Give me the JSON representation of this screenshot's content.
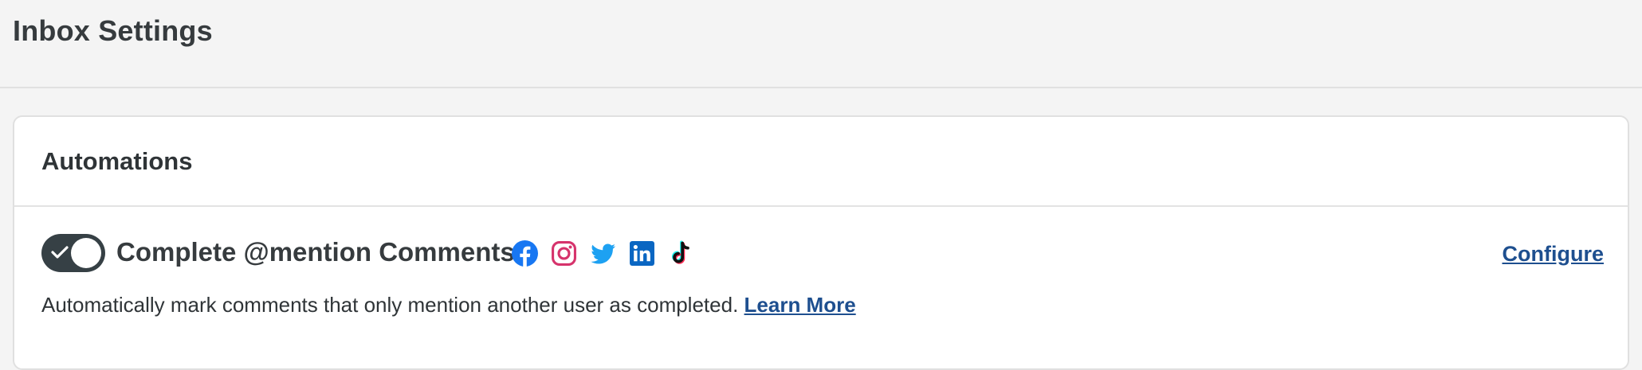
{
  "page": {
    "title": "Inbox Settings"
  },
  "automations": {
    "title": "Automations",
    "settings": [
      {
        "name": "Complete @mention Comments",
        "enabled": true,
        "networks": [
          "facebook-icon",
          "instagram-icon",
          "twitter-icon",
          "linkedin-icon",
          "tiktok-icon"
        ],
        "configure_label": "Configure",
        "description": "Automatically mark comments that only mention another user as completed.",
        "learn_more_label": "Learn More"
      }
    ]
  },
  "colors": {
    "toggle_on": "#364045",
    "link": "#1e4f8f",
    "facebook": "#1877f2",
    "instagram": "#d6336c",
    "twitter": "#1da1f2",
    "linkedin": "#0a66c2"
  }
}
